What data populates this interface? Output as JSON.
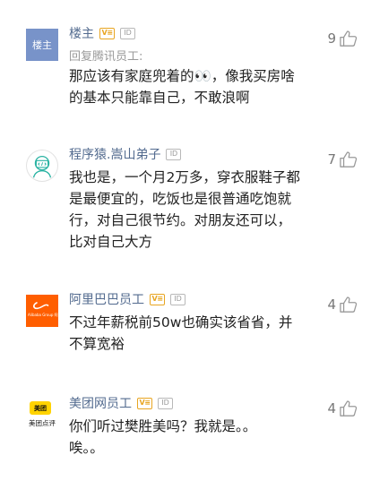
{
  "colors": {
    "username": "#536b8f",
    "badge": "#e8a521",
    "text": "#222222",
    "meta": "#9a9a9a",
    "likes": "#777777"
  },
  "badges": {
    "verified": "V≡",
    "id": "ID"
  },
  "comments": [
    {
      "username": "楼主",
      "avatar_label": "楼主",
      "reply_to": "回复腾讯员工:",
      "text": "那应该有家庭兜着的👀，像我买房啥\n的基本只能靠自己，不敢浪啊",
      "likes": "9"
    },
    {
      "username": "程序猿.嵩山弟子",
      "avatar_icon": "coder-icon",
      "text": "我也是，一个月2万多，穿衣服鞋子都\n是最便宜的，吃饭也是很普通吃饱就\n行，对自己很节约。对朋友还可以，\n比对自己大方",
      "likes": "7"
    },
    {
      "username": "阿里巴巴员工",
      "avatar_icon": "alibaba-logo",
      "avatar_text": "Alibaba Group 阿里巴巴集团",
      "text": "不过年薪税前50w也确实该省省，并\n不算宽裕",
      "likes": "4"
    },
    {
      "username": "美团网员工",
      "avatar_icon": "meituan-logo",
      "avatar_top": "美团",
      "avatar_bottom": "美团点评",
      "text": "你们听过樊胜美吗？我就是。。\n唉。。",
      "likes": "4"
    }
  ]
}
